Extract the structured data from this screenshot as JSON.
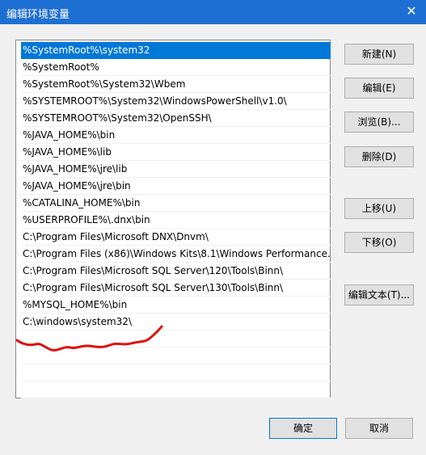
{
  "window": {
    "title": "编辑环境变量",
    "close_glyph": "✕"
  },
  "list": {
    "items": [
      "%SystemRoot%\\system32",
      "%SystemRoot%",
      "%SystemRoot%\\System32\\Wbem",
      "%SYSTEMROOT%\\System32\\WindowsPowerShell\\v1.0\\",
      "%SYSTEMROOT%\\System32\\OpenSSH\\",
      "%JAVA_HOME%\\bin",
      "%JAVA_HOME%\\lib",
      "%JAVA_HOME%\\jre\\lib",
      "%JAVA_HOME%\\jre\\bin",
      "%CATALINA_HOME%\\bin",
      "%USERPROFILE%\\.dnx\\bin",
      "C:\\Program Files\\Microsoft DNX\\Dnvm\\",
      "C:\\Program Files (x86)\\Windows Kits\\8.1\\Windows Performance...",
      "C:\\Program Files\\Microsoft SQL Server\\120\\Tools\\Binn\\",
      "C:\\Program Files\\Microsoft SQL Server\\130\\Tools\\Binn\\",
      "%MYSQL_HOME%\\bin",
      "C:\\windows\\system32\\"
    ],
    "selected_index": 0
  },
  "buttons": {
    "new": "新建(N)",
    "edit": "编辑(E)",
    "browse": "浏览(B)...",
    "delete": "删除(D)",
    "move_up": "上移(U)",
    "move_down": "下移(O)",
    "edit_text": "编辑文本(T)...",
    "ok": "确定",
    "cancel": "取消"
  },
  "colors": {
    "titlebar": "#1e6fd3",
    "selection": "#0078d7",
    "annotation_stroke": "#e01010"
  }
}
